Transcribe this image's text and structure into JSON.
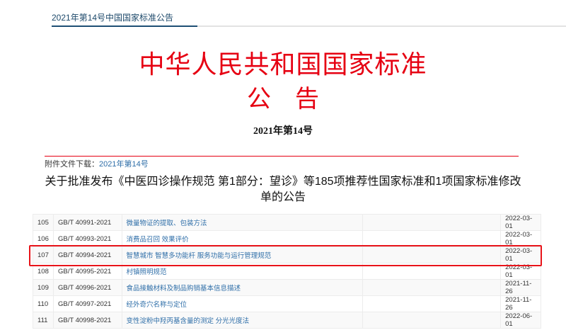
{
  "breadcrumb": {
    "title": "2021年第14号中国国家标准公告"
  },
  "header": {
    "title": "中华人民共和国国家标准",
    "subtitle": "公　告",
    "number": "2021年第14号"
  },
  "attachment": {
    "label": "附件文件下载：",
    "link": "2021年第14号"
  },
  "heading": "关于批准发布《中医四诊操作规范 第1部分：望诊》等185项推荐性国家标准和1项国家标准修改单的公告",
  "colors": {
    "red": "#e60012",
    "link": "#2e6ea8",
    "accent": "#1e4f74",
    "highlight": "#e8141a"
  },
  "rows": [
    {
      "no": "105",
      "code": "GB/T 40991-2021",
      "name": "微量物证的提取、包装方法",
      "extra": "",
      "date": "2022-03-01"
    },
    {
      "no": "106",
      "code": "GB/T 40993-2021",
      "name": "消费品召回 效果评价",
      "extra": "",
      "date": "2022-03-01"
    },
    {
      "no": "107",
      "code": "GB/T 40994-2021",
      "name": "智慧城市 智慧多功能杆 服务功能与运行管理规范",
      "extra": "",
      "date": "2022-03-01",
      "highlighted": true
    },
    {
      "no": "108",
      "code": "GB/T 40995-2021",
      "name": "村镇照明规范",
      "extra": "",
      "date": "2022-03-01"
    },
    {
      "no": "109",
      "code": "GB/T 40996-2021",
      "name": "食品接触材料及制品购销基本信息描述",
      "extra": "",
      "date": "2021-11-26"
    },
    {
      "no": "110",
      "code": "GB/T 40997-2021",
      "name": "经外奇穴名称与定位",
      "extra": "",
      "date": "2021-11-26"
    },
    {
      "no": "111",
      "code": "GB/T 40998-2021",
      "name": "变性淀粉中羟丙基含量的测定 分光光度法",
      "extra": "",
      "date": "2022-06-01"
    }
  ]
}
